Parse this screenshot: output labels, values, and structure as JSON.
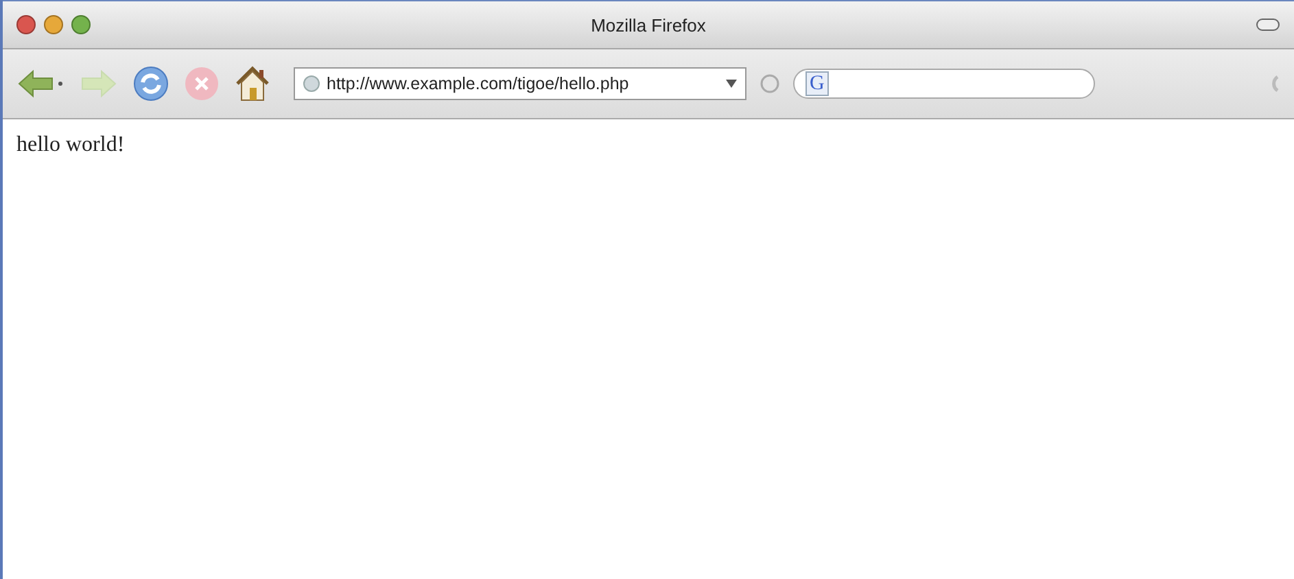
{
  "window": {
    "title": "Mozilla Firefox"
  },
  "toolbar": {
    "back": {
      "disabled": false
    },
    "forward": {
      "disabled": true
    },
    "stop": {
      "disabled": true
    },
    "url": "http://www.example.com/tigoe/hello.php",
    "search": {
      "engine_label": "G"
    }
  },
  "content": {
    "text": "hello world!"
  }
}
